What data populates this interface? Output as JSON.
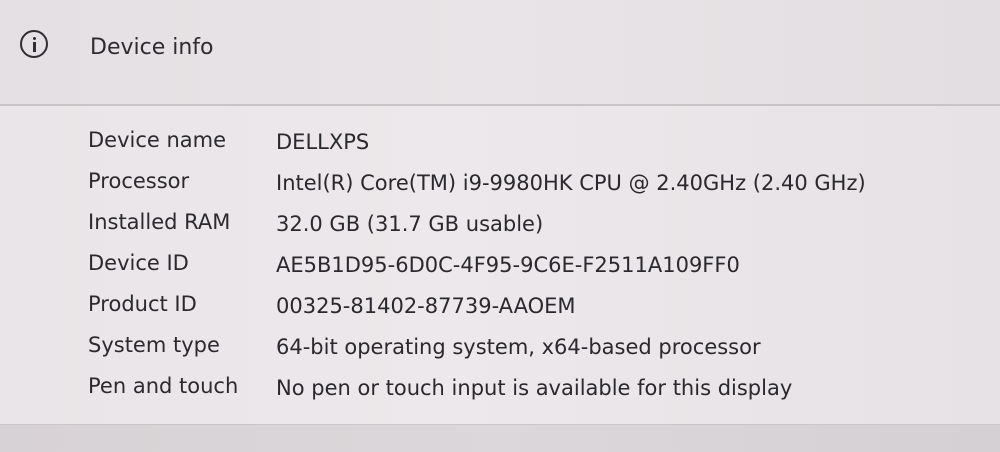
{
  "section": {
    "title": "Device info",
    "icon": "info-icon"
  },
  "specs": [
    {
      "label": "Device name",
      "value": "DELLXPS"
    },
    {
      "label": "Processor",
      "value": "Intel(R) Core(TM) i9-9980HK CPU @ 2.40GHz (2.40 GHz)"
    },
    {
      "label": "Installed RAM",
      "value": "32.0 GB (31.7 GB usable)"
    },
    {
      "label": "Device ID",
      "value": "AE5B1D95-6D0C-4F95-9C6E-F2511A109FF0"
    },
    {
      "label": "Product ID",
      "value": "00325-81402-87739-AAOEM"
    },
    {
      "label": "System type",
      "value": "64-bit operating system, x64-based processor"
    },
    {
      "label": "Pen and touch",
      "value": "No pen or touch input is available for this display"
    }
  ]
}
